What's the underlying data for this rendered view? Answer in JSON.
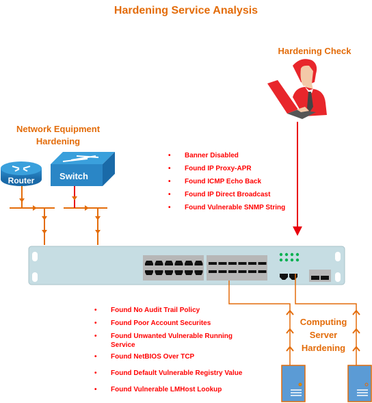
{
  "title": "Hardening Service Analysis",
  "hardening_check": {
    "title": "Hardening Check",
    "icon": "person-with-laptop-icon"
  },
  "network_equipment": {
    "title_line1": "Network Equipment",
    "title_line2": "Hardening",
    "devices": [
      {
        "label": "Router",
        "icon": "router-icon"
      },
      {
        "label": "Switch",
        "icon": "switch-icon"
      }
    ]
  },
  "network_findings": [
    "Banner Disabled",
    "Found IP Proxy-APR",
    "Found ICMP Echo Back",
    "Found IP Direct Broadcast",
    "Found Vulnerable SNMP String"
  ],
  "server_findings": [
    "Found No Audit Trail Policy",
    "Found Poor Account Securites",
    "Found Unwanted Vulnerable Running Service",
    "Found NetBIOS Over TCP",
    "Found Default Vulnerable Registry Value",
    "Found Vulnerable LMHost Lookup"
  ],
  "computing_server": {
    "title_line1": "Computing",
    "title_line2": "Server",
    "title_line3": "Hardening",
    "servers": [
      {
        "icon": "server-icon"
      },
      {
        "icon": "server-icon"
      }
    ]
  },
  "colors": {
    "heading": "#e36c0a",
    "finding_text": "#ff0000",
    "connector": "#e36c0a",
    "check_line": "#e8000b",
    "switch_chassis": "#c6dde3",
    "server_body": "#5b9bd5",
    "status_led": "#00b050"
  }
}
